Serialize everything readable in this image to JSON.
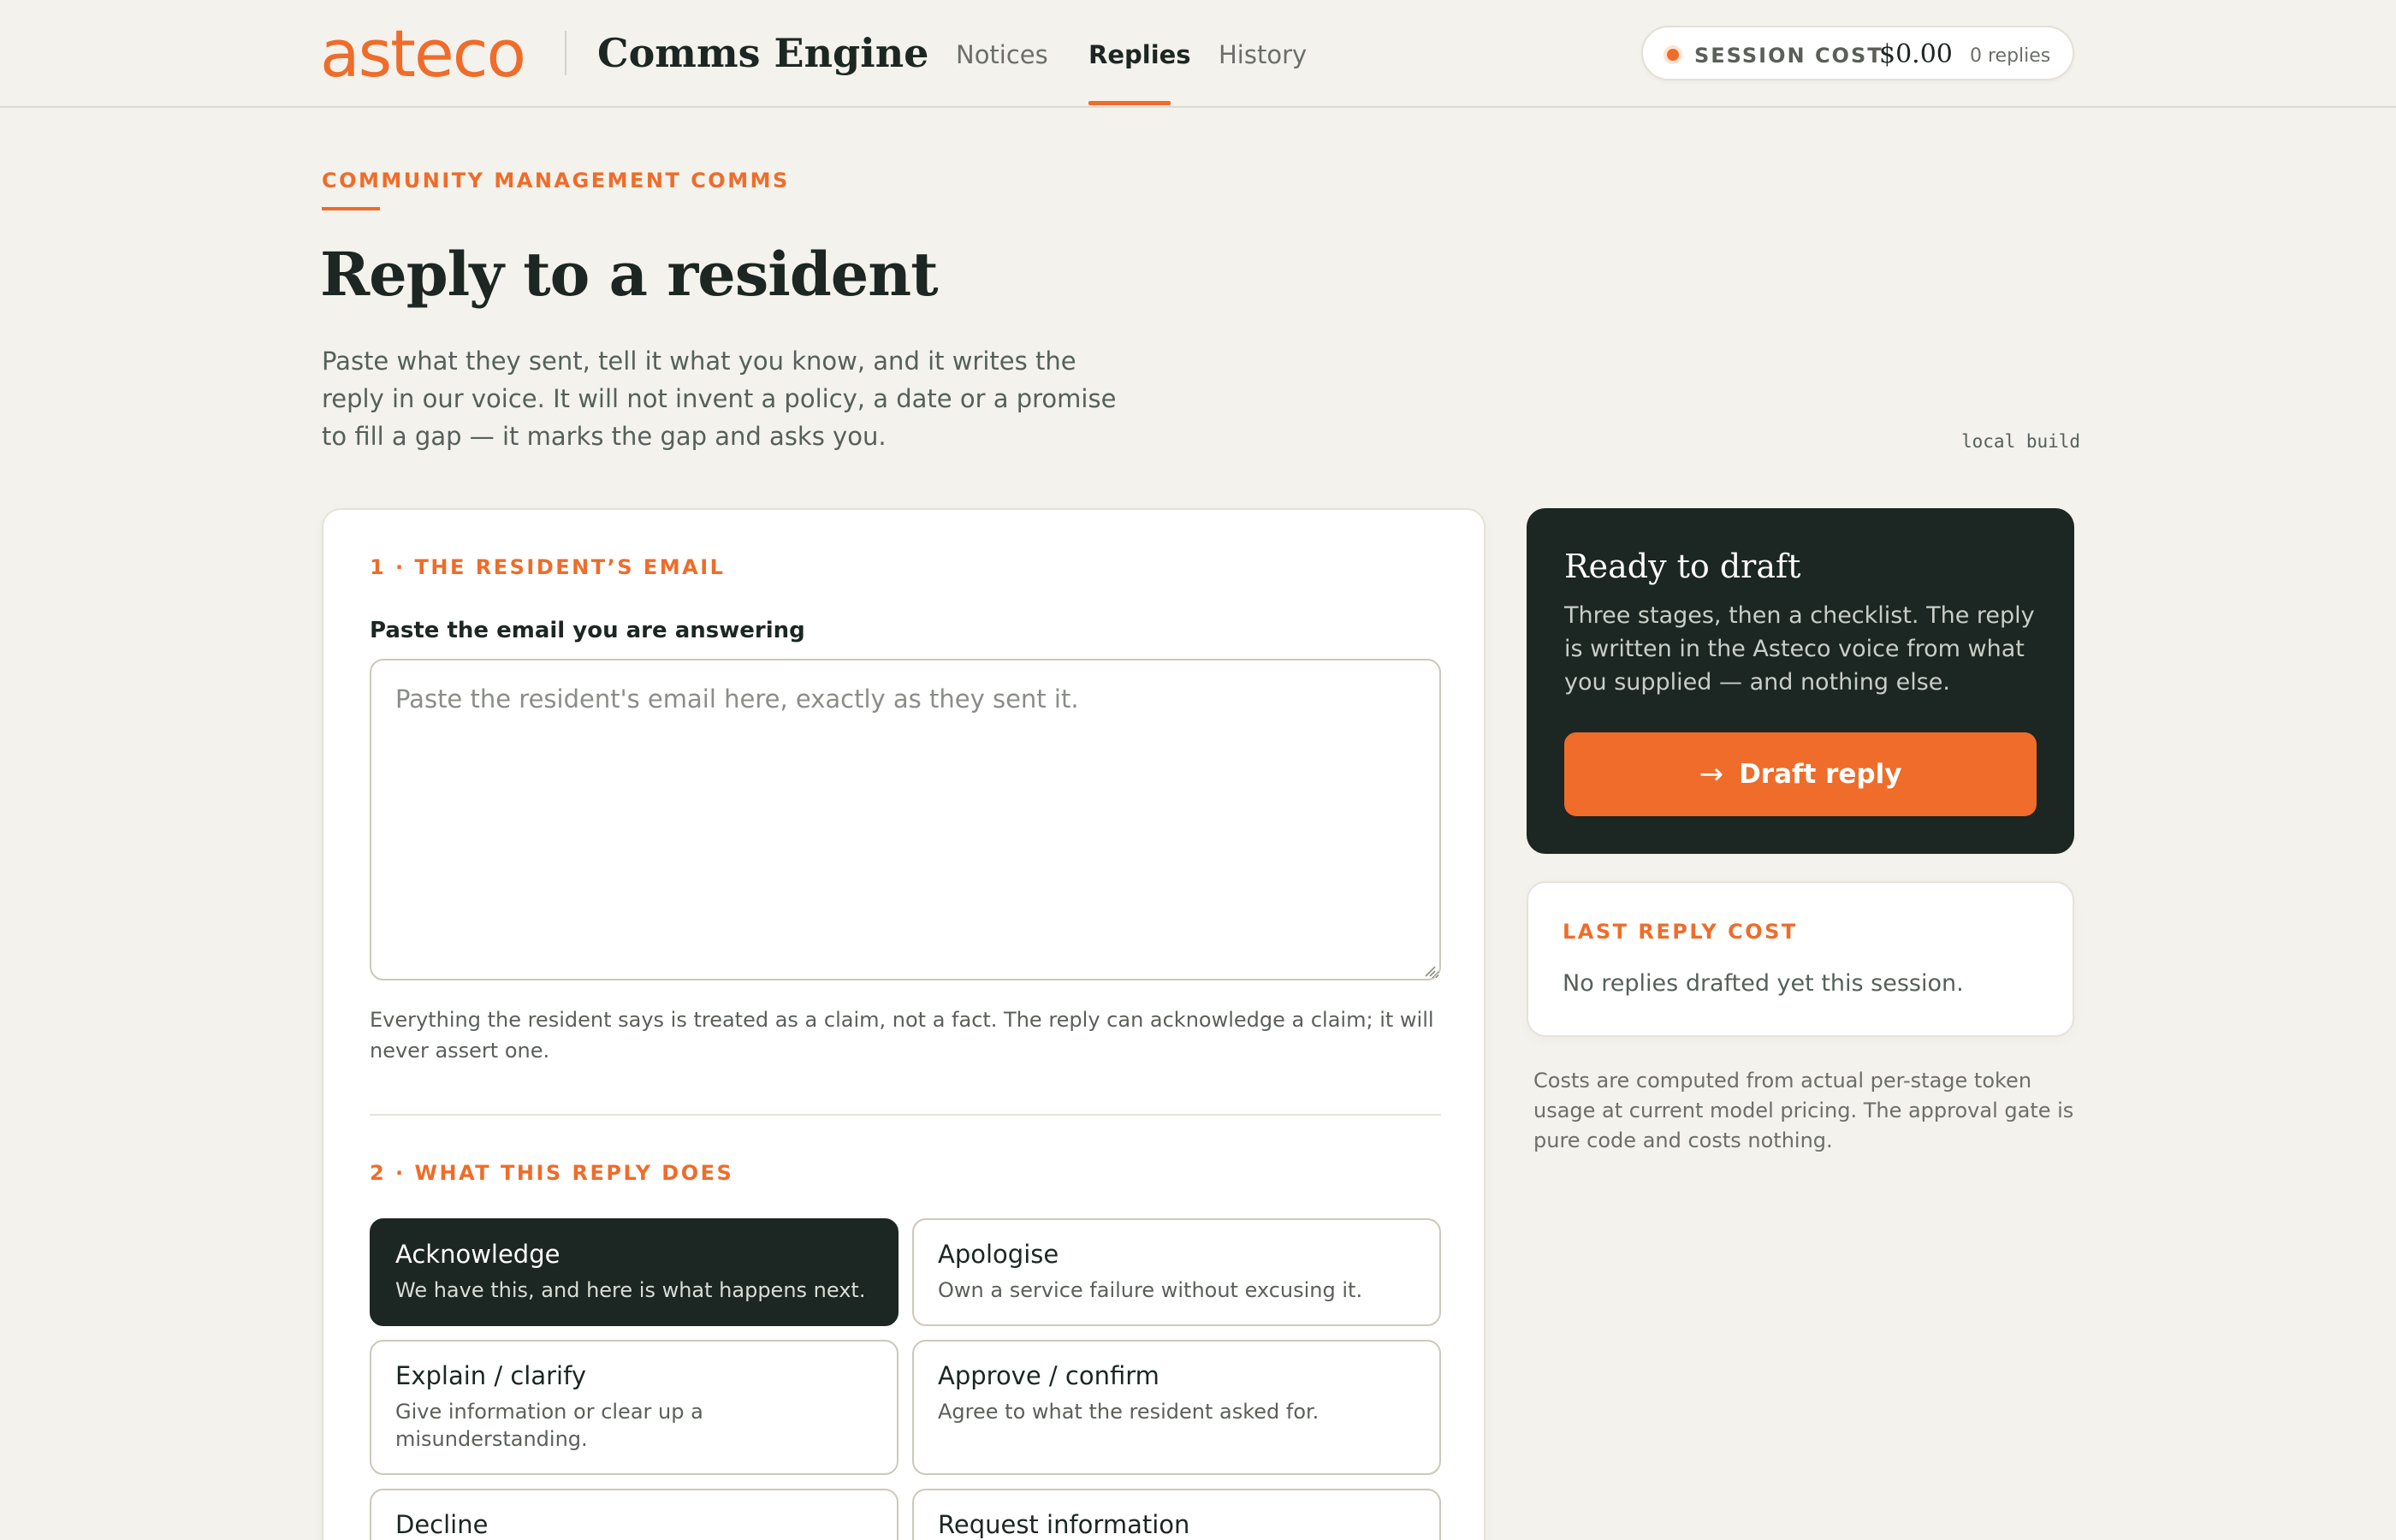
{
  "header": {
    "logo": "asteco",
    "app_name": "Comms Engine",
    "nav": [
      {
        "label": "Notices",
        "active": false
      },
      {
        "label": "Replies",
        "active": true
      },
      {
        "label": "History",
        "active": false
      }
    ],
    "session_cost": {
      "label": "SESSION COST",
      "value": "$0.00",
      "count": "0 replies"
    }
  },
  "page": {
    "eyebrow": "COMMUNITY MANAGEMENT COMMS",
    "title": "Reply to a resident",
    "intro": "Paste what they sent, tell it what you know, and it writes the reply in our voice. It will not invent a policy, a date or a promise to fill a gap — it marks the gap and asks you.",
    "build_tag": "local build"
  },
  "step1": {
    "label": "1 · THE RESIDENT’S EMAIL",
    "field_label": "Paste the email you are answering",
    "email_value": "",
    "email_placeholder": "Paste the resident's email here, exactly as they sent it.",
    "help": "Everything the resident says is treated as a claim, not a fact. The reply can acknowledge a claim; it will never assert one."
  },
  "step2": {
    "label": "2 · WHAT THIS REPLY DOES",
    "options": [
      {
        "title": "Acknowledge",
        "desc": "We have this, and here is what happens next.",
        "selected": true
      },
      {
        "title": "Apologise",
        "desc": "Own a service failure without excusing it.",
        "selected": false
      },
      {
        "title": "Explain / clarify",
        "desc": "Give information or clear up a misunderstanding.",
        "selected": false
      },
      {
        "title": "Approve / confirm",
        "desc": "Agree to what the resident asked for.",
        "selected": false
      },
      {
        "title": "Decline",
        "desc": "",
        "selected": false
      },
      {
        "title": "Request information",
        "desc": "",
        "selected": false
      }
    ]
  },
  "draft": {
    "title": "Ready to draft",
    "desc": "Three stages, then a checklist. The reply is written in the Asteco voice from what you supplied — and nothing else.",
    "arrow": "→",
    "button": "Draft reply"
  },
  "last_reply": {
    "label": "LAST REPLY COST",
    "text": "No replies drafted yet this session."
  },
  "cost_note": "Costs are computed from actual per-stage token usage at current model pricing. The approval gate is pure code and costs nothing.",
  "colors": {
    "accent": "#ef6c2a",
    "dark": "#1c2622",
    "background": "#f4f2ec"
  }
}
